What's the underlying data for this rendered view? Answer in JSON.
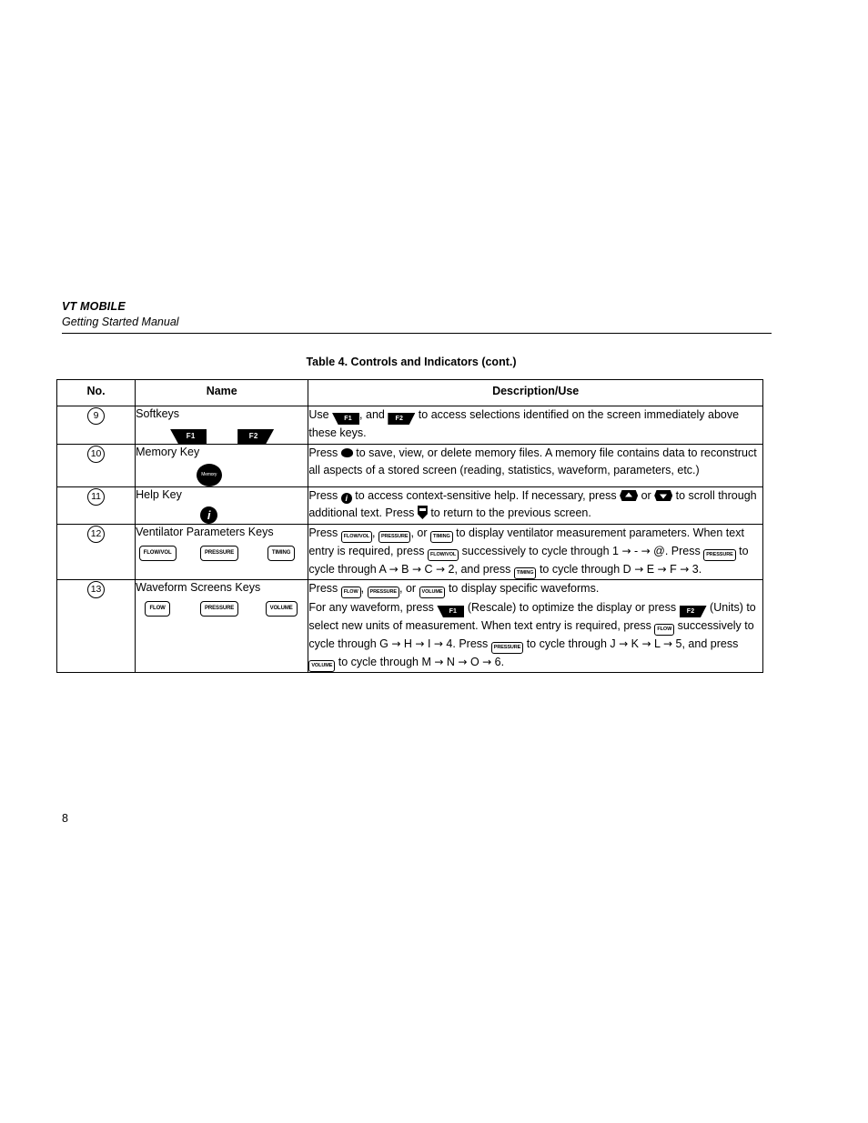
{
  "header": {
    "product": "VT MOBILE",
    "manual": "Getting Started Manual"
  },
  "table_caption": "Table 4. Controls and Indicators (cont.)",
  "columns": {
    "no": "No.",
    "name": "Name",
    "description": "Description/Use"
  },
  "page_number": "8",
  "keys": {
    "f1": "F1",
    "f2": "F2",
    "memory": "Memory",
    "help": "i",
    "flowvol": "FLOW/VOL",
    "pressure": "PRESSURE",
    "timing": "TIMING",
    "flow": "FLOW",
    "volume": "VOLUME"
  },
  "rows": [
    {
      "no": "9",
      "name": "Softkeys",
      "desc": {
        "p1_a": "Use ",
        "p1_b": ", and ",
        "p1_c": " to access selections identified on the screen immediately above these keys."
      }
    },
    {
      "no": "10",
      "name": "Memory Key",
      "desc": {
        "p1_a": "Press ",
        "p1_b": " to save, view, or delete memory files. A memory file contains data to reconstruct all aspects of a stored screen (reading, statistics, waveform, parameters, etc.)"
      }
    },
    {
      "no": "11",
      "name": "Help Key",
      "desc": {
        "p1_a": "Press ",
        "p1_b": " to access context-sensitive help. If necessary, press ",
        "p1_c": " or ",
        "p1_d": " to scroll through additional text. Press ",
        "p1_e": " to return to the previous screen."
      }
    },
    {
      "no": "12",
      "name": "Ventilator Parameters Keys",
      "desc": {
        "p1_a": "Press ",
        "p1_b": ", ",
        "p1_c": ", or ",
        "p1_d": " to display ventilator measurement parameters. When text entry is required, press ",
        "p1_e": " successively to cycle through 1 ",
        "p1_f": " - ",
        "p1_g": " @. Press ",
        "p1_h": " to cycle through A ",
        "p1_i": " B ",
        "p1_j": " C ",
        "p1_k": " 2, and press ",
        "p1_l": " to cycle through D ",
        "p1_m": " E ",
        "p1_n": " F ",
        "p1_o": " 3."
      }
    },
    {
      "no": "13",
      "name": "Waveform Screens Keys",
      "desc": {
        "p1_a": "Press ",
        "p1_b": ", ",
        "p1_c": ", or ",
        "p1_d": " to display specific waveforms.",
        "p2_a": "For any waveform, press ",
        "p2_b": " (Rescale) to optimize the display or press ",
        "p2_c": " (Units) to select new units of measurement. When text entry is required, press ",
        "p2_d": " successively to cycle through G ",
        "p2_e": " H ",
        "p2_f": " I ",
        "p2_g": " 4. Press ",
        "p2_h": " to cycle through J ",
        "p2_i": " K ",
        "p2_j": " L ",
        "p2_k": " 5, and press ",
        "p2_l": " to cycle through M ",
        "p2_m": " N ",
        "p2_n": " O ",
        "p2_o": " 6."
      }
    }
  ],
  "arrow_glyph": "→"
}
